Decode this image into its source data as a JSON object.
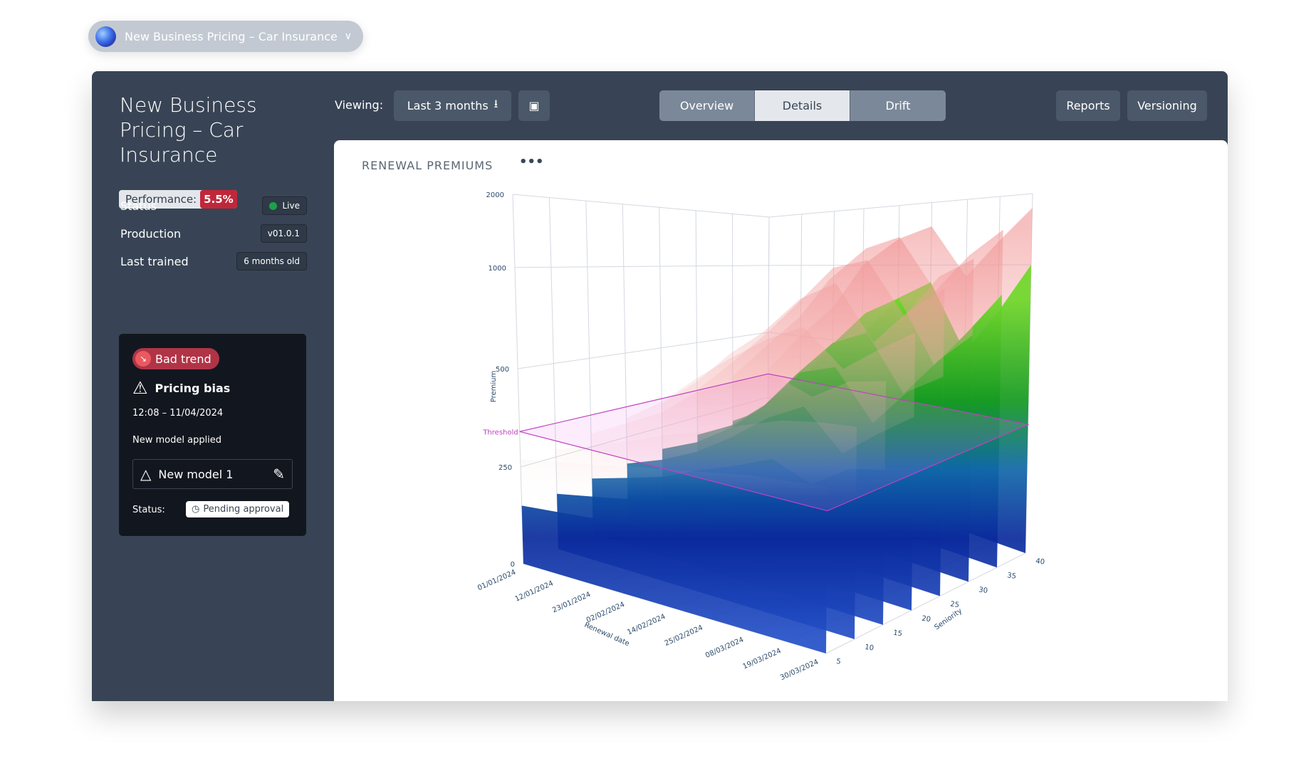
{
  "project_selector": {
    "title": "New Business Pricing – Car Insurance",
    "icon": "chevron-down-icon"
  },
  "sidebar": {
    "title": "New Business Pricing – Car Insurance",
    "performance_label": "Performance:",
    "performance_value": "5.5%",
    "rows": [
      {
        "label": "Status",
        "value": "Live"
      },
      {
        "label": "Production",
        "value": "v01.0.1"
      },
      {
        "label": "Last trained",
        "value": "6 months old"
      }
    ],
    "alert": {
      "trend": "Bad trend",
      "title": "Pricing bias",
      "time": "12:08 – 11/04/2024",
      "applied_label": "New model applied",
      "model": "New model 1",
      "status_label": "Status:",
      "status_value": "Pending approval"
    }
  },
  "toolbar": {
    "viewing_label": "Viewing:",
    "range": "Last 3 months",
    "tabs": [
      "Overview",
      "Details",
      "Drift"
    ],
    "active_tab": "Details",
    "reports": "Reports",
    "versioning": "Versioning"
  },
  "chart_card": {
    "title": "RENEWAL PREMIUMS",
    "more": "•••"
  },
  "colors": {
    "panel": "#384455",
    "threshold": "#c040c0",
    "alert": "#b03446",
    "live": "#1aa34a"
  },
  "chart_data": {
    "type": "surface3d",
    "xlabel": "Renewal date",
    "ylabel": "Seniority",
    "zlabel": "Premium",
    "x_ticks": [
      "01/01/2024",
      "12/01/2024",
      "23/01/2024",
      "02/02/2024",
      "14/02/2024",
      "25/02/2024",
      "08/03/2024",
      "19/03/2024",
      "30/03/2024"
    ],
    "y_ticks": [
      5,
      10,
      15,
      20,
      25,
      30,
      35,
      40
    ],
    "z_ticks": [
      0,
      250,
      500,
      1000,
      2000
    ],
    "z_scale": "log-like",
    "threshold": {
      "label": "Threshold",
      "value": 340
    },
    "surface": [
      {
        "seniority": 40,
        "premium": [
          200,
          280,
          400,
          560,
          800,
          900,
          520,
          750,
          1000
        ]
      },
      {
        "seniority": 35,
        "premium": [
          200,
          270,
          380,
          520,
          750,
          850,
          500,
          700,
          900
        ]
      },
      {
        "seniority": 30,
        "premium": [
          190,
          250,
          340,
          450,
          620,
          700,
          450,
          600,
          750
        ]
      },
      {
        "seniority": 25,
        "premium": [
          180,
          230,
          300,
          380,
          500,
          560,
          400,
          500,
          600
        ]
      },
      {
        "seniority": 20,
        "premium": [
          170,
          210,
          260,
          320,
          400,
          450,
          350,
          420,
          480
        ]
      },
      {
        "seniority": 15,
        "premium": [
          160,
          190,
          220,
          260,
          300,
          340,
          300,
          360,
          380
        ]
      },
      {
        "seniority": 10,
        "premium": [
          150,
          170,
          190,
          210,
          230,
          250,
          270,
          280,
          290
        ]
      },
      {
        "seniority": 5,
        "premium": [
          150,
          160,
          170,
          180,
          190,
          200,
          210,
          215,
          220
        ]
      }
    ],
    "upper_bound_factor": 1.8
  }
}
